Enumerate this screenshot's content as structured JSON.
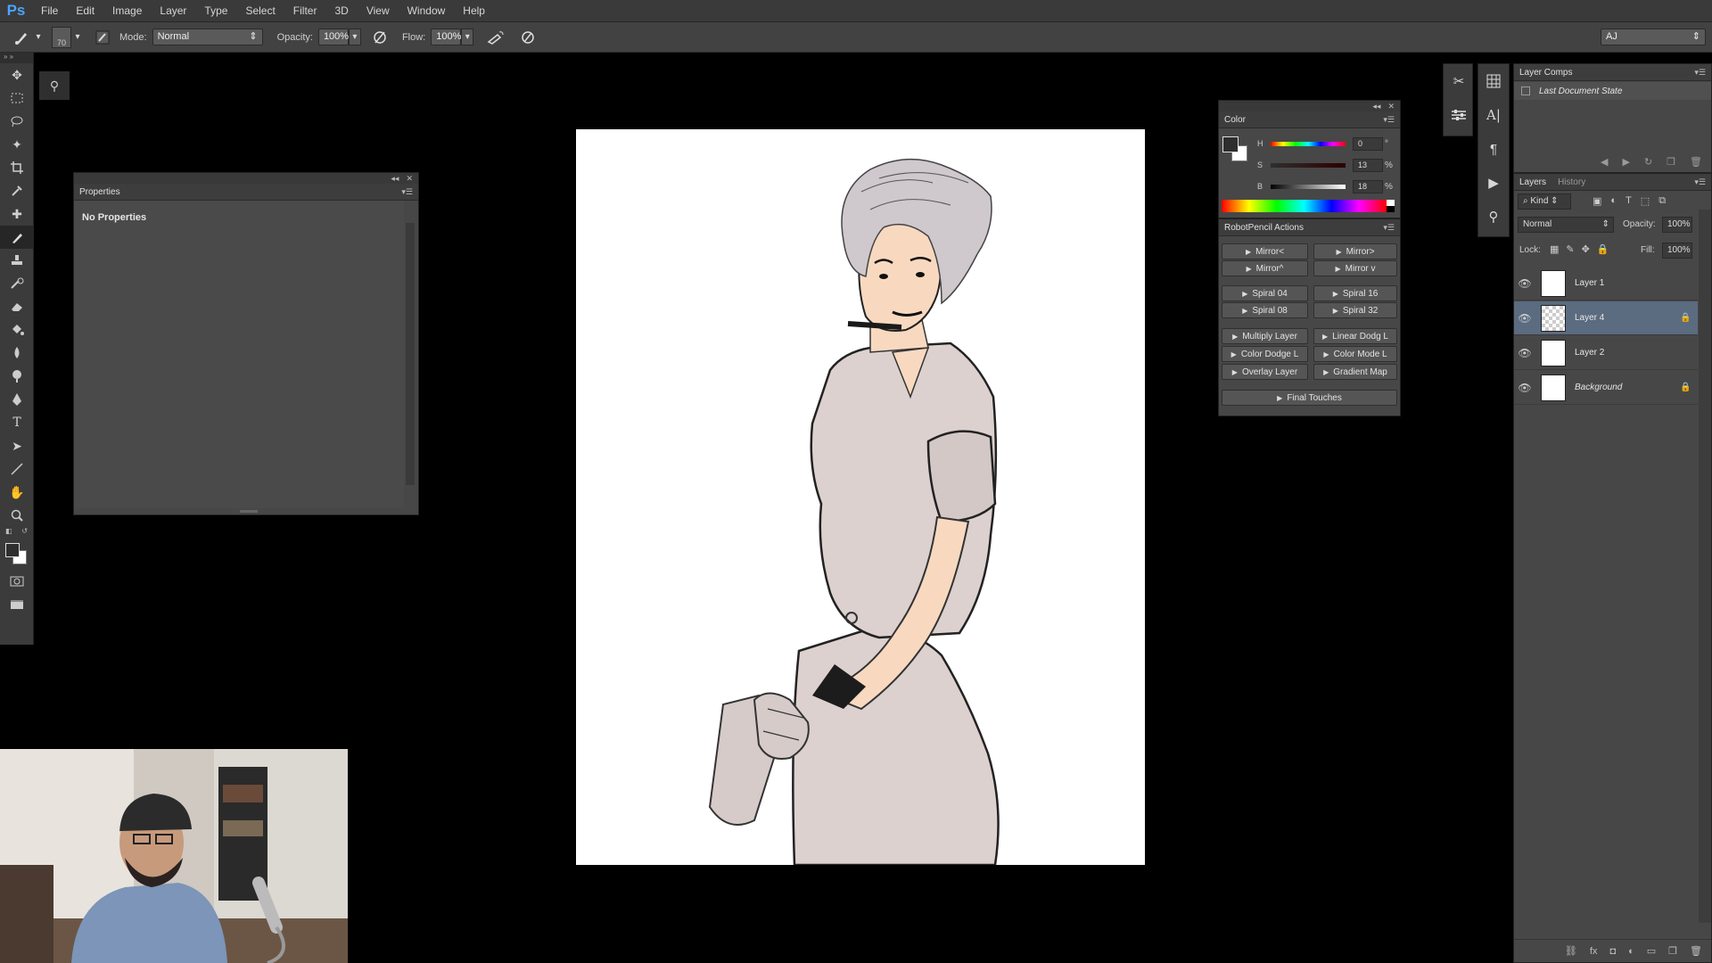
{
  "app": {
    "logo": "Ps",
    "menu": [
      "File",
      "Edit",
      "Image",
      "Layer",
      "Type",
      "Select",
      "Filter",
      "3D",
      "View",
      "Window",
      "Help"
    ]
  },
  "options_bar": {
    "brush_size": "70",
    "mode_label": "Mode:",
    "mode_value": "Normal",
    "opacity_label": "Opacity:",
    "opacity_value": "100%",
    "flow_label": "Flow:",
    "flow_value": "100%",
    "workspace_value": "AJ"
  },
  "properties": {
    "title": "Properties",
    "empty_text": "No Properties"
  },
  "color_panel": {
    "title": "Color",
    "h_label": "H",
    "h_value": "0",
    "h_unit": "°",
    "s_label": "S",
    "s_value": "13",
    "s_unit": "%",
    "b_label": "B",
    "b_value": "18",
    "b_unit": "%",
    "foreground": "#2e2e2e",
    "background": "#ffffff"
  },
  "actions_panel": {
    "title": "RobotPencil Actions",
    "buttons": [
      "Mirror<",
      "Mirror>",
      "Mirror^",
      "Mirror v",
      "Spiral 04",
      "Spiral 16",
      "Spiral 08",
      "Spiral 32",
      "Multiply Layer",
      "Linear Dodg L",
      "Color Dodge L",
      "Color Mode L",
      "Overlay Layer",
      "Gradient Map",
      "Final Touches"
    ]
  },
  "layer_comps": {
    "title": "Layer Comps",
    "item": "Last Document State"
  },
  "layers_panel": {
    "tab_layers": "Layers",
    "tab_history": "History",
    "kind_value": "Kind",
    "blend_value": "Normal",
    "opacity_label": "Opacity:",
    "opacity_value": "100%",
    "lock_label": "Lock:",
    "fill_label": "Fill:",
    "fill_value": "100%",
    "layers": [
      {
        "name": "Layer 1",
        "selected": false,
        "locked": false
      },
      {
        "name": "Layer 4",
        "selected": true,
        "locked": true
      },
      {
        "name": "Layer 2",
        "selected": false,
        "locked": false
      },
      {
        "name": "Background",
        "selected": false,
        "locked": true
      }
    ]
  },
  "colors": {
    "selection": "#5b6b80",
    "ps_blue": "#4aa4ff",
    "skin": "#f8d9c0",
    "shirt": "#d9cdcb",
    "hair": "#cfc8cd"
  }
}
